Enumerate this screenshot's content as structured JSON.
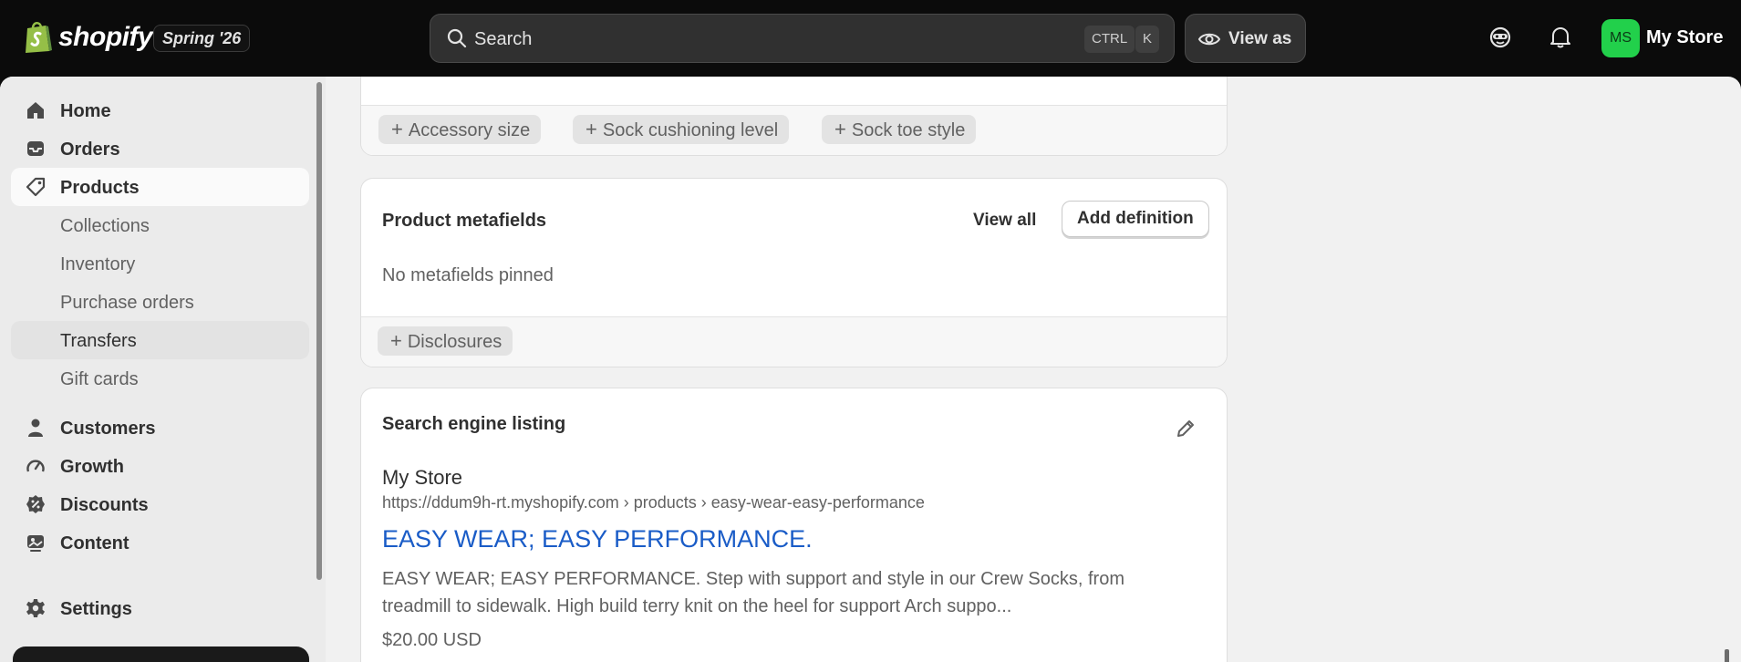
{
  "topbar": {
    "logo_text": "shopify",
    "edition_badge": "Spring '26",
    "search_placeholder": "Search",
    "shortcut_ctrl": "CTRL",
    "shortcut_key": "K",
    "view_as_label": "View as",
    "avatar_initials": "MS",
    "store_name": "My Store",
    "avatar_color": "#22d04b"
  },
  "sidebar": {
    "items": [
      {
        "label": "Home",
        "icon": "home-icon"
      },
      {
        "label": "Orders",
        "icon": "inbox-icon"
      },
      {
        "label": "Products",
        "icon": "tag-icon"
      },
      {
        "label": "Collections"
      },
      {
        "label": "Inventory"
      },
      {
        "label": "Purchase orders"
      },
      {
        "label": "Transfers"
      },
      {
        "label": "Gift cards"
      },
      {
        "label": "Customers",
        "icon": "person-icon"
      },
      {
        "label": "Growth",
        "icon": "gauge-icon"
      },
      {
        "label": "Discounts",
        "icon": "discount-icon"
      },
      {
        "label": "Content",
        "icon": "content-icon"
      },
      {
        "label": "Settings",
        "icon": "gear-icon"
      }
    ]
  },
  "attributes_card": {
    "pills": [
      "Accessory size",
      "Sock cushioning level",
      "Sock toe style"
    ]
  },
  "metafields_card": {
    "title": "Product metafields",
    "view_all": "View all",
    "add_definition": "Add definition",
    "empty_text": "No metafields pinned",
    "pill": "Disclosures"
  },
  "seo_card": {
    "title": "Search engine listing",
    "store": "My Store",
    "url": "https://ddum9h-rt.myshopify.com › products › easy-wear-easy-performance",
    "page_title": "EASY WEAR; EASY PERFORMANCE.",
    "description_line1": "EASY WEAR; EASY PERFORMANCE. Step with support and style in our Crew Socks, from",
    "description_line2": "treadmill to sidewalk. High build terry knit on the heel for support Arch suppo...",
    "price": "$20.00 USD",
    "link_color": "#1a5cc7"
  }
}
